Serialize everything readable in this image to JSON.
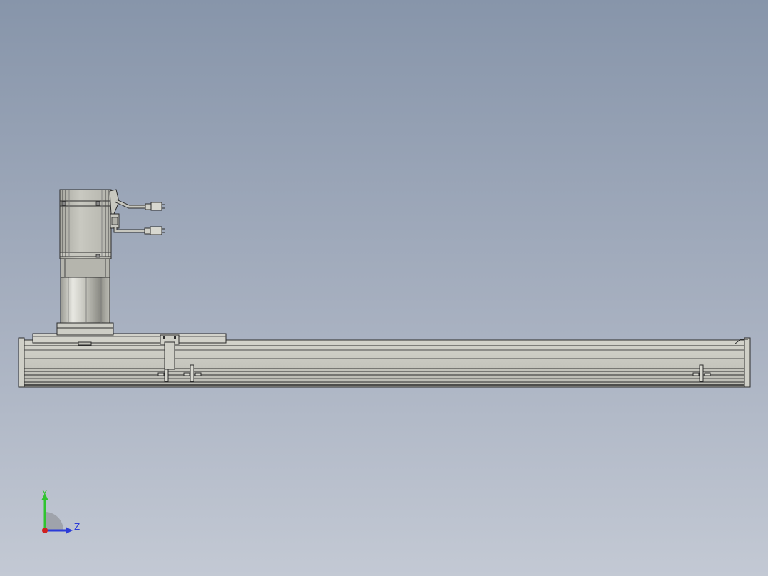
{
  "viewport": {
    "background_top": "#8795aa",
    "background_bottom": "#c3c9d4"
  },
  "model": {
    "parts": [
      "servo-motor",
      "gear-reducer",
      "carriage-plate",
      "linear-rail-module",
      "encoder-cable",
      "power-cable"
    ]
  },
  "triad": {
    "y_label": "Y",
    "z_label": "Z",
    "y_color": "#2fc42f",
    "z_color": "#2b3bd8",
    "x_color": "#d02020"
  }
}
